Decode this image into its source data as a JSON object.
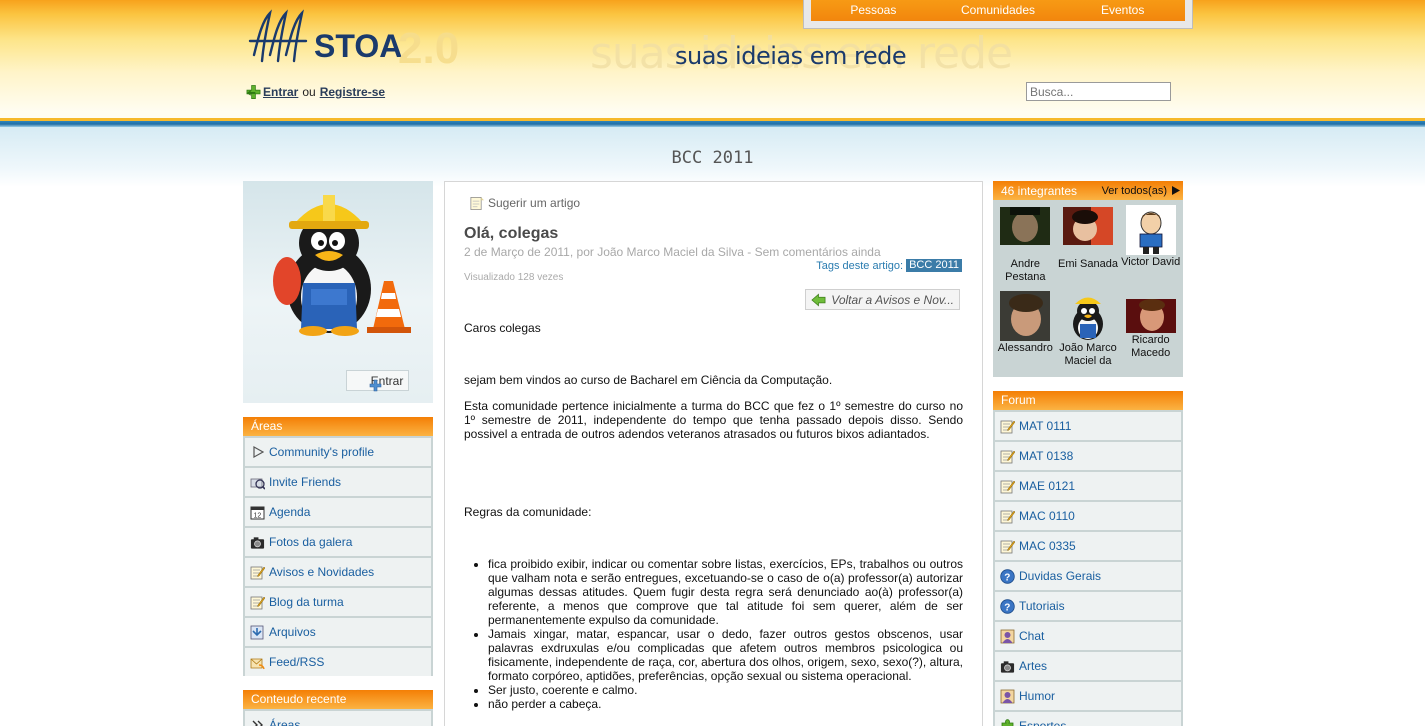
{
  "header": {
    "brand": "STOA",
    "brand_version": "2.0",
    "slogan": "suas ideias em rede",
    "nav": [
      "Pessoas",
      "Comunidades",
      "Eventos"
    ],
    "login_label": "Entrar",
    "or_label": "ou",
    "register_label": "Registre-se",
    "search_placeholder": "Busca..."
  },
  "page_title": "BCC 2011",
  "left": {
    "enter_label": "Entrar",
    "areas_title": "Áreas",
    "areas": [
      {
        "label": "Community's profile",
        "icon": "triangle-right-icon"
      },
      {
        "label": "Invite Friends",
        "icon": "invite-icon"
      },
      {
        "label": "Agenda",
        "icon": "calendar-icon"
      },
      {
        "label": "Fotos da galera",
        "icon": "camera-icon"
      },
      {
        "label": "Avisos e Novidades",
        "icon": "notepad-icon"
      },
      {
        "label": "Blog da turma",
        "icon": "notepad-icon"
      },
      {
        "label": "Arquivos",
        "icon": "folder-icon"
      },
      {
        "label": "Feed/RSS",
        "icon": "feed-icon"
      }
    ],
    "recent_title": "Conteudo recente",
    "recent_items": [
      "Áreas"
    ]
  },
  "article": {
    "suggest_label": "Sugerir um artigo",
    "title": "Olá, colegas",
    "meta": "2 de Março de 2011, por João Marco Maciel da Silva - Sem comentários ainda",
    "tags_label": "Tags deste artigo:",
    "tag": "BCC 2011",
    "views": "Visualizado 128 vezes",
    "back_label": "Voltar a Avisos e Nov...",
    "greeting": "Caros colegas",
    "welcome": "sejam bem vindos ao curso de Bacharel em Ciência da Computação.",
    "paragraph": "Esta comunidade pertence inicialmente a turma do BCC que fez o 1º semestre do curso no 1º semestre de 2011, independente do tempo que tenha passado depois disso. Sendo possivel a entrada de outros adendos veteranos atrasados ou futuros bixos adiantados.",
    "rules_title": "Regras da comunidade:",
    "rules": [
      " fica proibido exibir, indicar ou comentar sobre listas, exercícios, EPs, trabalhos ou outros que valham nota e serão entregues, excetuando-se o caso de o(a) professor(a) autorizar algumas dessas atitudes. Quem fugir desta regra será denunciado ao(à) professor(a) referente, a menos que comprove que tal atitude foi sem querer, além de ser permanentemente expulso da comunidade.",
      " Jamais xingar, matar, espancar, usar o dedo, fazer outros gestos obscenos, usar palavras exdruxulas e/ou complicadas que afetem outros membros psicologica ou fisicamente, independente de raça, cor, abertura dos olhos, origem, sexo, sexo(?), altura, formato corpóreo, aptidões, preferências, opção sexual ou sistema operacional.",
      " Ser justo, coerente e calmo.",
      " não perder a cabeça."
    ]
  },
  "right": {
    "members_count": "46 integrantes",
    "see_all": "Ver todos(as)",
    "members": [
      {
        "name": "Andre Pestana"
      },
      {
        "name": "Emi Sanada"
      },
      {
        "name": "Victor David"
      },
      {
        "name": "Alessandro"
      },
      {
        "name": "João Marco Maciel da"
      },
      {
        "name": "Ricardo Macedo"
      }
    ],
    "forum_title": "Forum",
    "forum": [
      {
        "label": "MAT 0111",
        "icon": "notepad-icon"
      },
      {
        "label": "MAT 0138",
        "icon": "notepad-icon"
      },
      {
        "label": "MAE 0121",
        "icon": "notepad-icon"
      },
      {
        "label": "MAC 0110",
        "icon": "notepad-icon"
      },
      {
        "label": "MAC 0335",
        "icon": "notepad-icon"
      },
      {
        "label": "Duvidas Gerais",
        "icon": "help-icon"
      },
      {
        "label": "Tutoriais",
        "icon": "help-icon"
      },
      {
        "label": "Chat",
        "icon": "chat-icon"
      },
      {
        "label": "Artes",
        "icon": "camera-icon"
      },
      {
        "label": "Humor",
        "icon": "chat-icon"
      },
      {
        "label": "Esportes",
        "icon": "puzzle-icon"
      }
    ]
  },
  "colors": {
    "orange": "#f47f05",
    "link": "#1a5fa0",
    "panel": "#c9d4d4"
  }
}
